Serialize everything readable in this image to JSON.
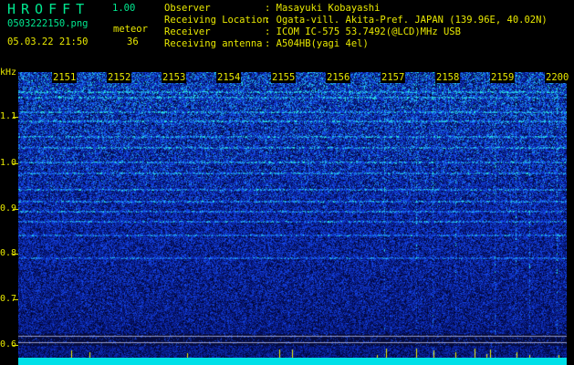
{
  "header": {
    "title": "HROFFT",
    "version": "1.00",
    "filename": "0503222150.png",
    "mode": "meteor",
    "datetime": "05.03.22 21:50",
    "count": "36"
  },
  "info": [
    {
      "label": "Observer",
      "value": ": Masayuki Kobayashi"
    },
    {
      "label": "Receiving Location",
      "value": ": Ogata-vill. Akita-Pref. JAPAN (139.96E, 40.02N)"
    },
    {
      "label": "Receiver",
      "value": ": ICOM IC-575 53.7492(@LCD)MHz USB"
    },
    {
      "label": "Receiving antenna",
      "value": ": A504HB(yagi 4el)"
    }
  ],
  "y_axis": {
    "unit": "kHz",
    "ticks": [
      "1.1",
      "1.0",
      "0.9",
      "0.8",
      "0.7",
      "0.6"
    ]
  },
  "x_axis": {
    "ticks": [
      "2151",
      "2152",
      "2153",
      "2154",
      "2155",
      "2156",
      "2157",
      "2158",
      "2159",
      "2200"
    ]
  },
  "colors": {
    "background": "#000000",
    "noise_low": "#0a1a7a",
    "noise_mid": "#2040d0",
    "noise_high": "#00e0e0",
    "baseline": "#00e0e8",
    "label": "#e8e800"
  }
}
